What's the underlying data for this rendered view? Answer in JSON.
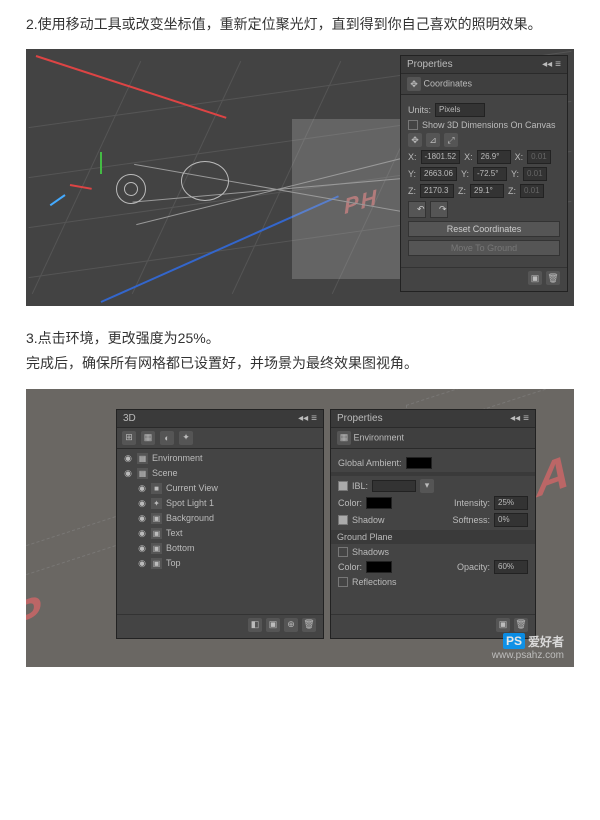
{
  "texts": {
    "step2": "2.使用移动工具或改变坐标值，重新定位聚光灯，直到得到你自己喜欢的照明效果。",
    "step3a": "3.点击环境，更改强度为25%。",
    "step3b": "完成后，确保所有网格都已设置好，并场景为最终效果图视角。"
  },
  "decor": {
    "pinkText1": "PH",
    "pinkText2a": "P",
    "pinkText2b": "A"
  },
  "panel1": {
    "title": "Properties",
    "subtitle": "Coordinates",
    "unitsLabel": "Units:",
    "unitsValue": "Pixels",
    "show3d": "Show 3D Dimensions On Canvas",
    "coords": {
      "x": {
        "v": "-1801.52",
        "a": "26.9°",
        "s": "0.01"
      },
      "y": {
        "v": "2663.06",
        "a": "-72.5°",
        "s": "0.01"
      },
      "z": {
        "v": "2170.3",
        "a": "29.1°",
        "s": "0.01"
      }
    },
    "resetBtn": "Reset Coordinates",
    "moveBtn": "Move To Ground",
    "undo": "↶",
    "redo": "↷"
  },
  "panel3d": {
    "title": "3D",
    "items": [
      {
        "label": "Environment",
        "icon": "▦",
        "indent": 0,
        "eye": "◉"
      },
      {
        "label": "Scene",
        "icon": "▦",
        "indent": 0,
        "eye": "◉"
      },
      {
        "label": "Current View",
        "icon": "■",
        "indent": 1,
        "eye": "◉"
      },
      {
        "label": "Spot Light 1",
        "icon": "✦",
        "indent": 1,
        "eye": "◉"
      },
      {
        "label": "Background",
        "icon": "▣",
        "indent": 1,
        "eye": "◉"
      },
      {
        "label": "Text",
        "icon": "▣",
        "indent": 1,
        "eye": "◉"
      },
      {
        "label": "Bottom",
        "icon": "▣",
        "indent": 1,
        "eye": "◉"
      },
      {
        "label": "Top",
        "icon": "▣",
        "indent": 1,
        "eye": "◉"
      }
    ]
  },
  "panelEnv": {
    "title": "Properties",
    "subtitle": "Environment",
    "globalAmbient": "Global Ambient:",
    "iblLabel": "IBL:",
    "colorLabel": "Color:",
    "intensityLabel": "Intensity:",
    "intensityValue": "25%",
    "shadowLabel": "Shadow",
    "softnessLabel": "Softness:",
    "softnessValue": "0%",
    "groundPlane": "Ground Plane",
    "shadowsLabel": "Shadows",
    "opacityLabel": "Opacity:",
    "opacityValue": "60%",
    "reflections": "Reflections"
  },
  "watermark": {
    "brand": "爱好者",
    "sub": "www.psahz.com",
    "ps": "PS"
  }
}
